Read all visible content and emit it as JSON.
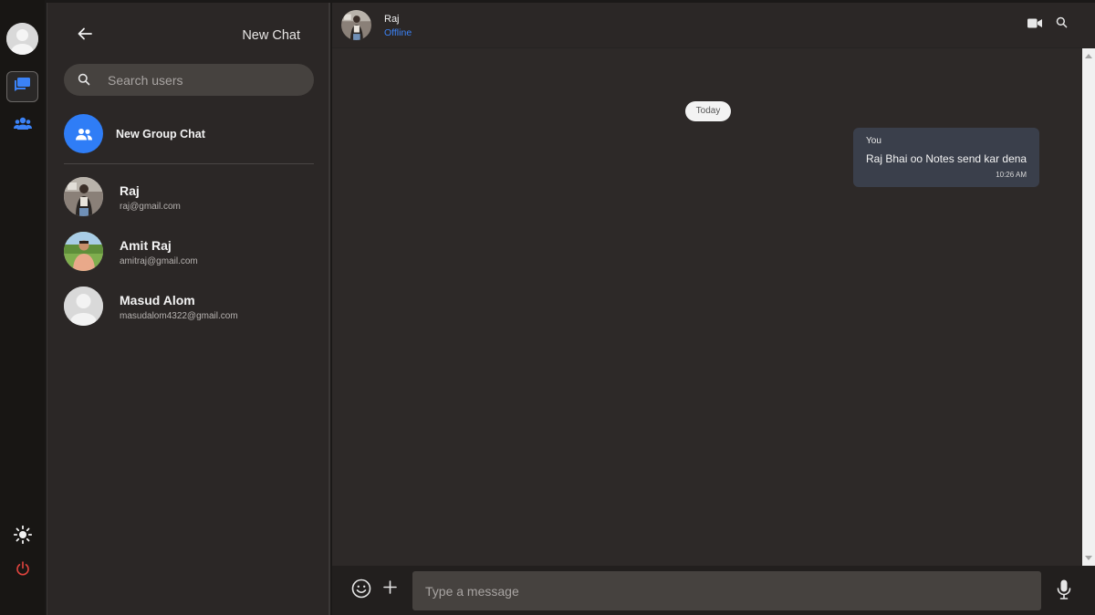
{
  "rail": {
    "icons": [
      "user-avatar",
      "chat-icon",
      "groups-icon",
      "sun-icon",
      "power-icon"
    ],
    "active_color": "#3b82f6",
    "power_color": "#e0443e"
  },
  "sidebar": {
    "title": "New Chat",
    "search": {
      "placeholder": "Search users"
    },
    "new_group_label": "New Group Chat",
    "contacts": [
      {
        "name": "Raj",
        "email": "raj@gmail.com",
        "avatar": "photo"
      },
      {
        "name": "Amit Raj",
        "email": "amitraj@gmail.com",
        "avatar": "photo"
      },
      {
        "name": "Masud Alom",
        "email": "masudalom4322@gmail.com",
        "avatar": "default"
      }
    ]
  },
  "chat": {
    "contact_name": "Raj",
    "status": "Offline",
    "status_color": "#3b82f6",
    "date_label": "Today",
    "messages": [
      {
        "sender": "You",
        "text": "Raj Bhai oo Notes send kar dena",
        "time": "10:26 AM",
        "outgoing": true
      }
    ],
    "composer": {
      "placeholder": "Type a message"
    }
  },
  "colors": {
    "accent": "#2f7df6",
    "bubble": "#3a3f4b",
    "panel": "#2b2726"
  }
}
